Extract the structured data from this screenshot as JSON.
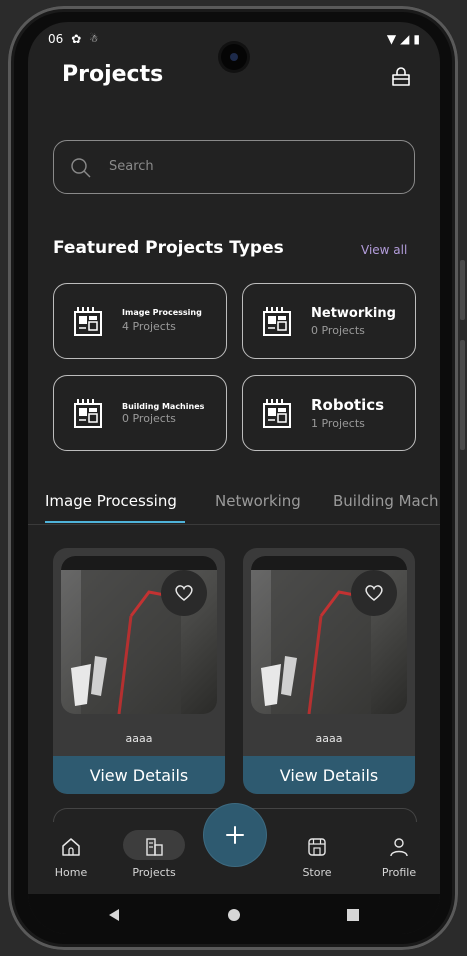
{
  "status": {
    "time": "06",
    "icons": [
      "settings-icon",
      "notification-icon"
    ],
    "right_icons": [
      "wifi-icon",
      "signal-icon",
      "battery-icon"
    ]
  },
  "header": {
    "title": "Projects",
    "cart_icon": "shopping-bag-icon"
  },
  "search": {
    "placeholder": "Search"
  },
  "featured": {
    "title": "Featured Projects Types",
    "view_all": "View all",
    "cards": [
      {
        "name": "Image Processing",
        "count": "4 Projects"
      },
      {
        "name": "Networking",
        "count": "0 Projects"
      },
      {
        "name": "Building Machines",
        "count": "0 Projects"
      },
      {
        "name": "Robotics",
        "count": "1 Projects"
      }
    ]
  },
  "tabs": [
    {
      "label": "Image Processing",
      "active": true
    },
    {
      "label": "Networking",
      "active": false
    },
    {
      "label": "Building Mach",
      "active": false
    }
  ],
  "projects": [
    {
      "name": "aaaa",
      "button": "View Details"
    },
    {
      "name": "aaaa",
      "button": "View Details"
    }
  ],
  "nav": {
    "items": [
      {
        "label": "Home",
        "icon": "home-icon"
      },
      {
        "label": "Projects",
        "icon": "projects-icon",
        "active": true
      },
      {
        "label": "Store",
        "icon": "store-icon"
      },
      {
        "label": "Profile",
        "icon": "profile-icon"
      }
    ],
    "fab_icon": "plus-icon"
  },
  "colors": {
    "accent": "#2e5a70",
    "view_all": "#b39ddb",
    "tab_indicator": "#4fb3d9",
    "background": "#222222"
  }
}
